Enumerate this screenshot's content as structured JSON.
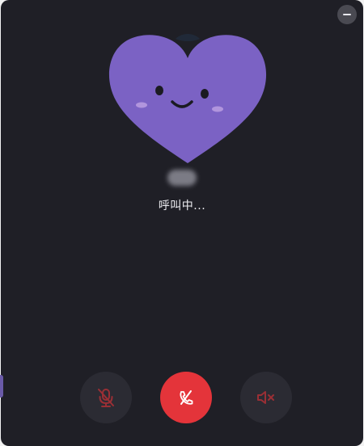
{
  "window": {
    "minimize_icon": "minimize-icon"
  },
  "callee": {
    "avatar_icon": "heart-face-avatar",
    "avatar_color": "#7b62c4",
    "status_text": "呼叫中..."
  },
  "controls": {
    "mute_icon": "mic-off-icon",
    "hangup_icon": "phone-hangup-icon",
    "speaker_icon": "speaker-off-icon",
    "hangup_color": "#e4343a",
    "disabled_icon_color": "#b0343a"
  }
}
